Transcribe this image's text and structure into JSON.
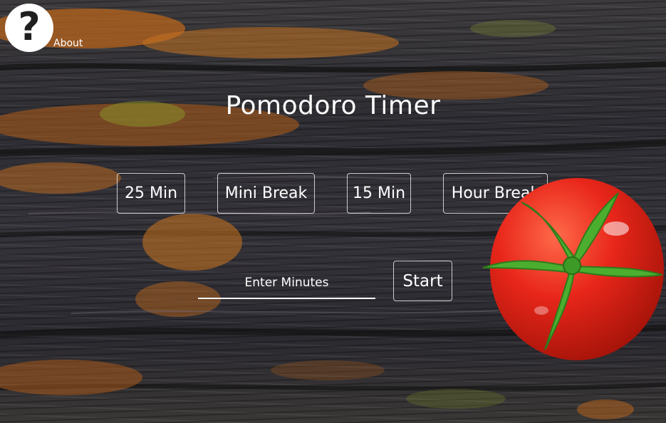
{
  "about": {
    "icon": "question-circle-icon",
    "label": "About"
  },
  "title": "Pomodoro Timer",
  "presets": [
    {
      "label": "25 Min"
    },
    {
      "label": "Mini Break"
    },
    {
      "label": "15 Min"
    },
    {
      "label": "Hour Break"
    }
  ],
  "custom": {
    "placeholder": "Enter Minutes",
    "value": "",
    "start_label": "Start"
  },
  "colors": {
    "text": "#ffffff",
    "tomato": "#e8261a",
    "stem": "#4cae2f",
    "wood_dark": "#2e2d33",
    "lichen_orange": "#c6701f"
  }
}
